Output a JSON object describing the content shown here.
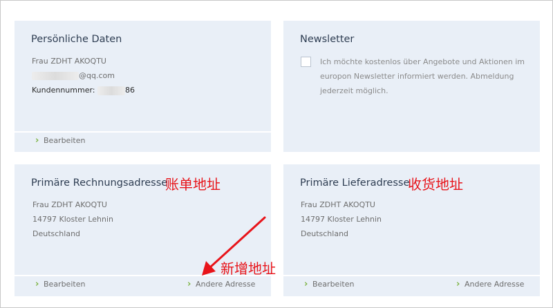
{
  "personal": {
    "title": "Persönliche Daten",
    "name": "Frau ZDHT AKOQTU",
    "email_suffix": "@qq.com",
    "customer_number_label": "Kundennummer:",
    "customer_number_start": "",
    "customer_number_end": "86",
    "edit": "Bearbeiten"
  },
  "newsletter": {
    "title": "Newsletter",
    "text": "Ich möchte kostenlos über Angebote und Aktionen im europon Newsletter informiert werden. Abmeldung jederzeit möglich."
  },
  "billing": {
    "title": "Primäre Rechnungsadresse",
    "annotation": "账单地址",
    "name": "Frau ZDHT AKOQTU",
    "city": "14797 Kloster Lehnin",
    "country": "Deutschland",
    "edit": "Bearbeiten",
    "other": "Andere Adresse",
    "add_annotation": "新增地址"
  },
  "shipping": {
    "title": "Primäre Lieferadresse",
    "annotation": "收货地址",
    "name": "Frau ZDHT AKOQTU",
    "city": "14797 Kloster Lehnin",
    "country": "Deutschland",
    "edit": "Bearbeiten",
    "other": "Andere Adresse"
  },
  "colors": {
    "card_bg": "#e9eff7",
    "accent_chevron": "#7cb342",
    "annotation": "#e8141a"
  }
}
